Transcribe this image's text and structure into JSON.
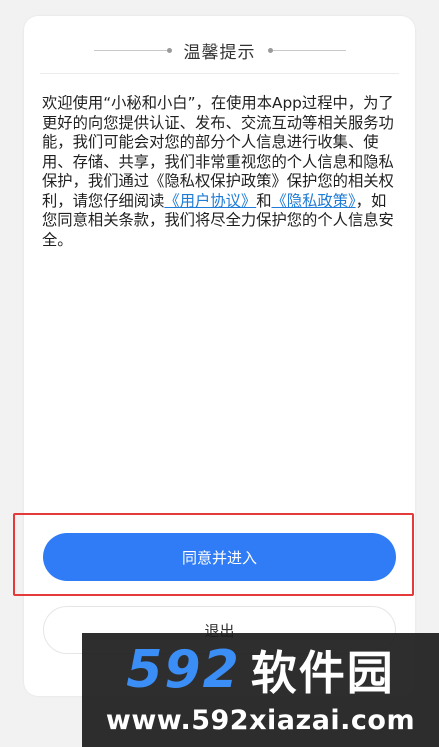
{
  "dialog": {
    "title": "温馨提示",
    "body_part1": "欢迎使用“小秘和小白”，在使用本App过程中，为了更好的向您提供认证、发布、交流互动等相关服务功能，我们可能会对您的部分个人信息进行收集、使用、存储、共享，我们非常重视您的个人信息和隐私保护，我们通过《隐私权保护政策》保护您的相关权利，请您仔细阅读",
    "user_agreement_link": "《用户协议》",
    "body_and": "和",
    "privacy_policy_link": "《隐私政策》",
    "body_part2": "，如您同意相关条款，我们将尽全力保护您的个人信息安全。",
    "agree_button": "同意并进入",
    "exit_button": "退出"
  },
  "watermark": {
    "brand_number": "592",
    "brand_text": "软件园",
    "url": "www.592xiazai.com"
  },
  "colors": {
    "primary": "#2f7cf6",
    "link": "#1f7bd6",
    "highlight_border": "#e43a3a"
  }
}
